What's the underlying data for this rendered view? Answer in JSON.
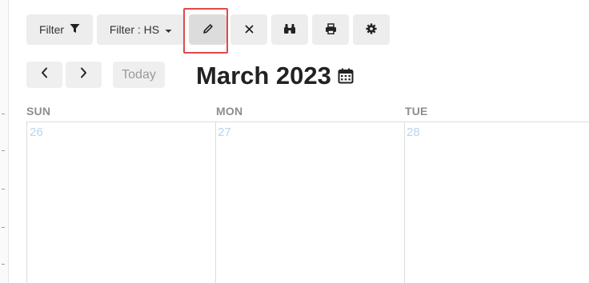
{
  "toolbar": {
    "filter_label": "Filter",
    "filter_hs_label": "Filter : HS",
    "buttons": {
      "filter": {
        "icon": "funnel-icon"
      },
      "filter_hs": {
        "icon": "caret-down-icon"
      },
      "edit": {
        "icon": "pencil-icon",
        "state": "highlighted"
      },
      "clear": {
        "icon": "close-icon"
      },
      "find": {
        "icon": "binoculars-icon"
      },
      "print": {
        "icon": "printer-icon"
      },
      "settings": {
        "icon": "gear-icon"
      }
    }
  },
  "nav": {
    "prev_icon": "chevron-left-icon",
    "next_icon": "chevron-right-icon",
    "today_label": "Today"
  },
  "calendar": {
    "month_title": "March 2023",
    "title_icon": "calendar-icon",
    "columns": [
      {
        "day_of_week": "SUN",
        "date": "26"
      },
      {
        "day_of_week": "MON",
        "date": "27"
      },
      {
        "day_of_week": "TUE",
        "date": "28"
      }
    ]
  },
  "colors": {
    "button_bg": "#ededed",
    "highlight_border": "#e0484b",
    "day_number": "#b8d4f0",
    "day_header": "#8e8e8e",
    "grid_line": "#dcdcdc"
  }
}
